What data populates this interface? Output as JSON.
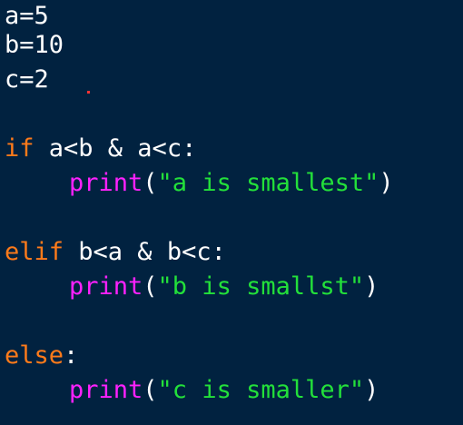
{
  "code": {
    "line1": "a=5",
    "line2": "b=10",
    "line3": "c=2",
    "if_kw": "if",
    "if_cond": " a<b & a<c:",
    "print1_fn": "print",
    "print1_open": "(",
    "print1_str": "\"a is smallest\"",
    "print1_close": ")",
    "elif_kw": "elif",
    "elif_cond": " b<a & b<c:",
    "print2_fn": "print",
    "print2_open": "(",
    "print2_str": "\"b is smallst\"",
    "print2_close": ")",
    "else_kw": "else",
    "else_colon": ":",
    "print3_fn": "print",
    "print3_open": "(",
    "print3_str": "\"c is smaller\"",
    "print3_close": ")"
  },
  "colors": {
    "background": "#012240",
    "keyword": "#ff7b1a",
    "function": "#ff21ff",
    "string": "#23e03a",
    "text": "#ffffff"
  }
}
